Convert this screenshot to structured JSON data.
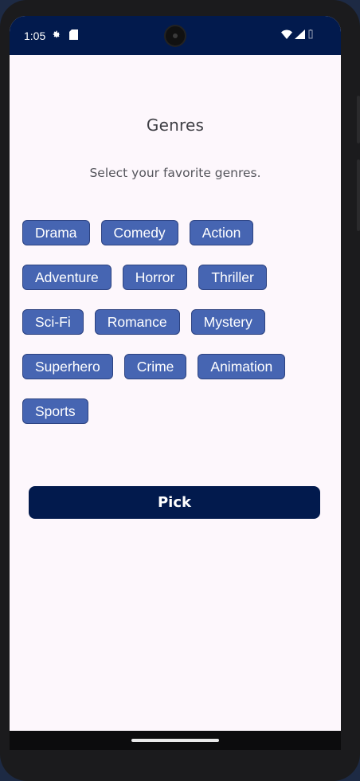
{
  "status_bar": {
    "time": "1:05",
    "icons": [
      "settings-gear-icon",
      "sd-card-icon",
      "wifi-icon",
      "cellular-signal-icon",
      "battery-icon"
    ]
  },
  "screen": {
    "title": "Genres",
    "subtitle": "Select your favorite genres.",
    "genres": [
      [
        "Drama",
        "Comedy",
        "Action"
      ],
      [
        "Adventure",
        "Horror",
        "Thriller"
      ],
      [
        "Sci-Fi",
        "Romance",
        "Mystery"
      ],
      [
        "Superhero",
        "Crime",
        "Animation"
      ],
      [
        "Sports"
      ]
    ],
    "pick_label": "Pick"
  },
  "colors": {
    "status_bar": "#021a4d",
    "chip": "#4665b2",
    "chip_border": "#2c4280",
    "pick_button": "#021a4d",
    "background": "#fdf7fc"
  }
}
